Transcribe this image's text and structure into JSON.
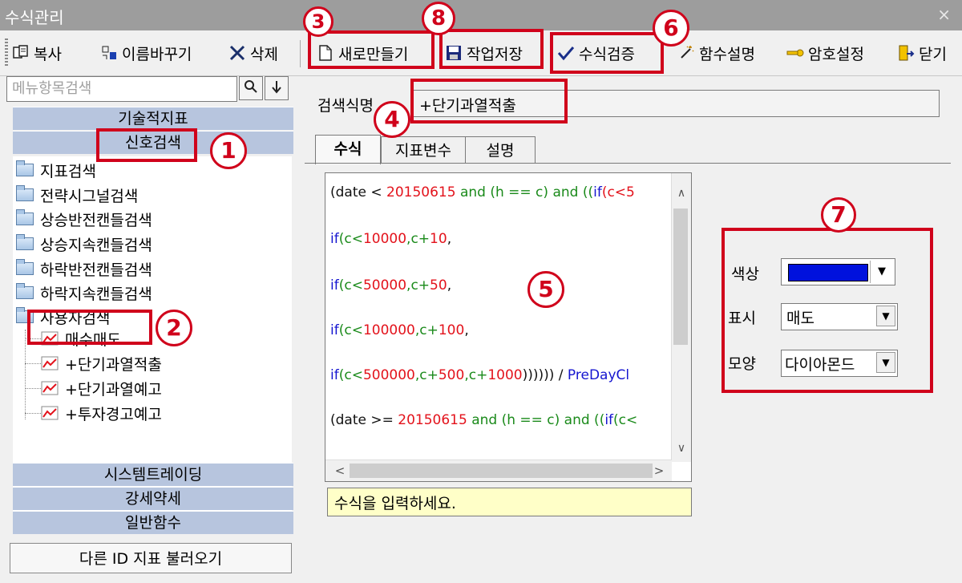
{
  "window": {
    "title": "수식관리",
    "close": "×"
  },
  "toolbar": {
    "copy": "복사",
    "rename": "이름바꾸기",
    "delete": "삭제",
    "new": "새로만들기",
    "save": "작업저장",
    "verify": "수식검증",
    "func_help": "함수설명",
    "password": "암호설정",
    "close": "닫기"
  },
  "left": {
    "search_placeholder": "메뉴항목검색",
    "categories_top": [
      "기술적지표",
      "신호검색"
    ],
    "folders": [
      "지표검색",
      "전략시그널검색",
      "상승반전캔들검색",
      "상승지속캔들검색",
      "하락반전캔들검색",
      "하락지속캔들검색",
      "사용자검색"
    ],
    "children": [
      "매수매도",
      "+단기과열적출",
      "+단기과열예고",
      "+투자경고예고"
    ],
    "categories_bottom": [
      "시스템트레이딩",
      "강세약세",
      "일반함수"
    ],
    "load_other": "다른 ID 지표 불러오기"
  },
  "main": {
    "name_label": "검색식명",
    "name_value": "+단기과열적출",
    "tabs": [
      "수식",
      "지표변수",
      "설명"
    ],
    "formula": [
      [
        [
          "(date < ",
          "k"
        ],
        [
          "20150615",
          "kr"
        ],
        [
          " and (h == c) and ((",
          "kg"
        ],
        [
          "if",
          "kb"
        ],
        [
          "(c<5",
          "kr"
        ]
      ],
      [
        [
          "if",
          "kb"
        ],
        [
          "(c<",
          "kg"
        ],
        [
          "10000",
          "kr"
        ],
        [
          ",c+",
          "kg"
        ],
        [
          "10",
          "kr"
        ],
        [
          ",",
          "k"
        ]
      ],
      [
        [
          "if",
          "kb"
        ],
        [
          "(c<",
          "kg"
        ],
        [
          "50000",
          "kr"
        ],
        [
          ",c+",
          "kg"
        ],
        [
          "50",
          "kr"
        ],
        [
          ",",
          "k"
        ]
      ],
      [
        [
          "if",
          "kb"
        ],
        [
          "(c<",
          "kg"
        ],
        [
          "100000",
          "kr"
        ],
        [
          ",c+",
          "kg"
        ],
        [
          "100",
          "kr"
        ],
        [
          ",",
          "k"
        ]
      ],
      [
        [
          "if",
          "kb"
        ],
        [
          "(c<",
          "kg"
        ],
        [
          "500000",
          "kr"
        ],
        [
          ",c+",
          "kg"
        ],
        [
          "500",
          "kr"
        ],
        [
          ",c+",
          "kg"
        ],
        [
          "1000",
          "kr"
        ],
        [
          ")))))) / ",
          "k"
        ],
        [
          "PreDayCl",
          "kb"
        ]
      ],
      [
        [
          "(date >= ",
          "k"
        ],
        [
          "20150615",
          "kr"
        ],
        [
          " and (h == c) and ((",
          "kg"
        ],
        [
          "if",
          "kb"
        ],
        [
          "(c<",
          "kg"
        ]
      ]
    ],
    "hint": "수식을 입력하세요."
  },
  "props": {
    "color_label": "색상",
    "color_value": "#0011dd",
    "display_label": "표시",
    "display_value": "매도",
    "shape_label": "모양",
    "shape_value": "다이아몬드"
  },
  "annotations": [
    "1",
    "2",
    "3",
    "4",
    "5",
    "6",
    "7",
    "8"
  ],
  "colors": {
    "highlight": "#d0021b",
    "category_bar": "#b7c5de",
    "titlebar": "#9d9d9d"
  }
}
